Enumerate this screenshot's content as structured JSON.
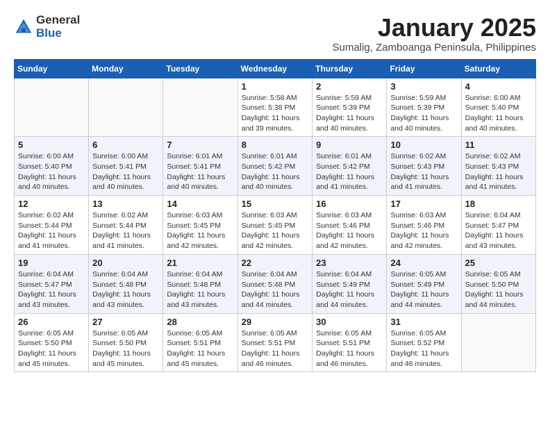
{
  "logo": {
    "general": "General",
    "blue": "Blue"
  },
  "title": "January 2025",
  "subtitle": "Sumalig, Zamboanga Peninsula, Philippines",
  "weekdays": [
    "Sunday",
    "Monday",
    "Tuesday",
    "Wednesday",
    "Thursday",
    "Friday",
    "Saturday"
  ],
  "weeks": [
    [
      {
        "day": "",
        "info": ""
      },
      {
        "day": "",
        "info": ""
      },
      {
        "day": "",
        "info": ""
      },
      {
        "day": "1",
        "info": "Sunrise: 5:58 AM\nSunset: 5:38 PM\nDaylight: 11 hours and 39 minutes."
      },
      {
        "day": "2",
        "info": "Sunrise: 5:59 AM\nSunset: 5:39 PM\nDaylight: 11 hours and 40 minutes."
      },
      {
        "day": "3",
        "info": "Sunrise: 5:59 AM\nSunset: 5:39 PM\nDaylight: 11 hours and 40 minutes."
      },
      {
        "day": "4",
        "info": "Sunrise: 6:00 AM\nSunset: 5:40 PM\nDaylight: 11 hours and 40 minutes."
      }
    ],
    [
      {
        "day": "5",
        "info": "Sunrise: 6:00 AM\nSunset: 5:40 PM\nDaylight: 11 hours and 40 minutes."
      },
      {
        "day": "6",
        "info": "Sunrise: 6:00 AM\nSunset: 5:41 PM\nDaylight: 11 hours and 40 minutes."
      },
      {
        "day": "7",
        "info": "Sunrise: 6:01 AM\nSunset: 5:41 PM\nDaylight: 11 hours and 40 minutes."
      },
      {
        "day": "8",
        "info": "Sunrise: 6:01 AM\nSunset: 5:42 PM\nDaylight: 11 hours and 40 minutes."
      },
      {
        "day": "9",
        "info": "Sunrise: 6:01 AM\nSunset: 5:42 PM\nDaylight: 11 hours and 41 minutes."
      },
      {
        "day": "10",
        "info": "Sunrise: 6:02 AM\nSunset: 5:43 PM\nDaylight: 11 hours and 41 minutes."
      },
      {
        "day": "11",
        "info": "Sunrise: 6:02 AM\nSunset: 5:43 PM\nDaylight: 11 hours and 41 minutes."
      }
    ],
    [
      {
        "day": "12",
        "info": "Sunrise: 6:02 AM\nSunset: 5:44 PM\nDaylight: 11 hours and 41 minutes."
      },
      {
        "day": "13",
        "info": "Sunrise: 6:02 AM\nSunset: 5:44 PM\nDaylight: 11 hours and 41 minutes."
      },
      {
        "day": "14",
        "info": "Sunrise: 6:03 AM\nSunset: 5:45 PM\nDaylight: 11 hours and 42 minutes."
      },
      {
        "day": "15",
        "info": "Sunrise: 6:03 AM\nSunset: 5:45 PM\nDaylight: 11 hours and 42 minutes."
      },
      {
        "day": "16",
        "info": "Sunrise: 6:03 AM\nSunset: 5:46 PM\nDaylight: 11 hours and 42 minutes."
      },
      {
        "day": "17",
        "info": "Sunrise: 6:03 AM\nSunset: 5:46 PM\nDaylight: 11 hours and 42 minutes."
      },
      {
        "day": "18",
        "info": "Sunrise: 6:04 AM\nSunset: 5:47 PM\nDaylight: 11 hours and 43 minutes."
      }
    ],
    [
      {
        "day": "19",
        "info": "Sunrise: 6:04 AM\nSunset: 5:47 PM\nDaylight: 11 hours and 43 minutes."
      },
      {
        "day": "20",
        "info": "Sunrise: 6:04 AM\nSunset: 5:48 PM\nDaylight: 11 hours and 43 minutes."
      },
      {
        "day": "21",
        "info": "Sunrise: 6:04 AM\nSunset: 5:48 PM\nDaylight: 11 hours and 43 minutes."
      },
      {
        "day": "22",
        "info": "Sunrise: 6:04 AM\nSunset: 5:48 PM\nDaylight: 11 hours and 44 minutes."
      },
      {
        "day": "23",
        "info": "Sunrise: 6:04 AM\nSunset: 5:49 PM\nDaylight: 11 hours and 44 minutes."
      },
      {
        "day": "24",
        "info": "Sunrise: 6:05 AM\nSunset: 5:49 PM\nDaylight: 11 hours and 44 minutes."
      },
      {
        "day": "25",
        "info": "Sunrise: 6:05 AM\nSunset: 5:50 PM\nDaylight: 11 hours and 44 minutes."
      }
    ],
    [
      {
        "day": "26",
        "info": "Sunrise: 6:05 AM\nSunset: 5:50 PM\nDaylight: 11 hours and 45 minutes."
      },
      {
        "day": "27",
        "info": "Sunrise: 6:05 AM\nSunset: 5:50 PM\nDaylight: 11 hours and 45 minutes."
      },
      {
        "day": "28",
        "info": "Sunrise: 6:05 AM\nSunset: 5:51 PM\nDaylight: 11 hours and 45 minutes."
      },
      {
        "day": "29",
        "info": "Sunrise: 6:05 AM\nSunset: 5:51 PM\nDaylight: 11 hours and 46 minutes."
      },
      {
        "day": "30",
        "info": "Sunrise: 6:05 AM\nSunset: 5:51 PM\nDaylight: 11 hours and 46 minutes."
      },
      {
        "day": "31",
        "info": "Sunrise: 6:05 AM\nSunset: 5:52 PM\nDaylight: 11 hours and 46 minutes."
      },
      {
        "day": "",
        "info": ""
      }
    ]
  ]
}
